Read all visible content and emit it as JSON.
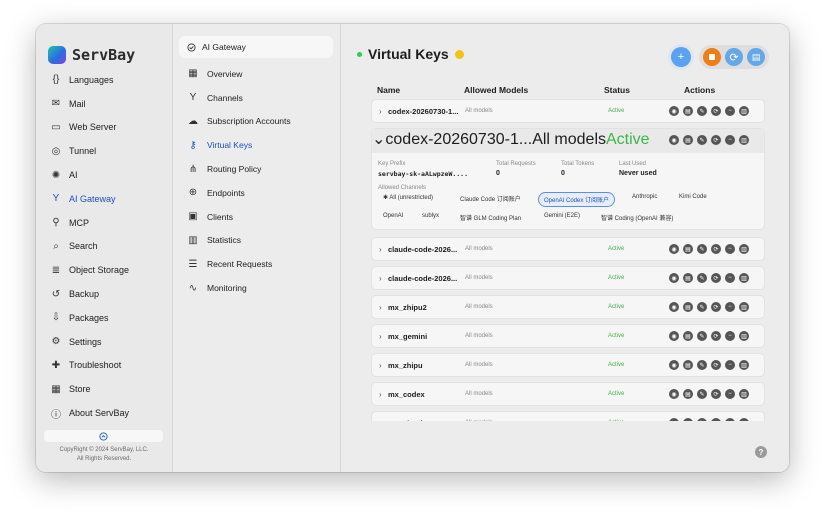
{
  "app": {
    "name": "ServBay"
  },
  "sidebar": {
    "items": [
      {
        "label": "Languages",
        "icon": "code-braces-icon"
      },
      {
        "label": "Mail",
        "icon": "mail-icon"
      },
      {
        "label": "Web Server",
        "icon": "server-icon"
      },
      {
        "label": "Tunnel",
        "icon": "tunnel-icon"
      },
      {
        "label": "AI",
        "icon": "ai-chip-icon"
      },
      {
        "label": "AI Gateway",
        "icon": "gateway-icon",
        "active": true
      },
      {
        "label": "MCP",
        "icon": "mcp-icon"
      },
      {
        "label": "Search",
        "icon": "search-icon"
      },
      {
        "label": "Object Storage",
        "icon": "storage-icon"
      },
      {
        "label": "Backup",
        "icon": "backup-icon"
      },
      {
        "label": "Packages",
        "icon": "packages-icon"
      },
      {
        "label": "Settings",
        "icon": "gear-icon"
      },
      {
        "label": "Troubleshoot",
        "icon": "troubleshoot-icon"
      },
      {
        "label": "Store",
        "icon": "store-icon"
      },
      {
        "label": "About ServBay",
        "icon": "info-icon"
      }
    ],
    "copyright_line1": "CopyRight © 2024 ServBay, LLC.",
    "copyright_line2": "All Rights Reserved."
  },
  "subnav": {
    "header": "AI Gateway",
    "items": [
      {
        "label": "Overview",
        "icon": "grid-icon"
      },
      {
        "label": "Channels",
        "icon": "channels-icon"
      },
      {
        "label": "Subscription Accounts",
        "icon": "accounts-icon"
      },
      {
        "label": "Virtual Keys",
        "icon": "key-icon",
        "active": true
      },
      {
        "label": "Routing Policy",
        "icon": "routing-icon"
      },
      {
        "label": "Endpoints",
        "icon": "endpoints-icon"
      },
      {
        "label": "Clients",
        "icon": "terminal-icon"
      },
      {
        "label": "Statistics",
        "icon": "bar-chart-icon"
      },
      {
        "label": "Recent Requests",
        "icon": "list-icon"
      },
      {
        "label": "Monitoring",
        "icon": "pulse-icon"
      }
    ]
  },
  "main": {
    "title": "Virtual Keys",
    "columns": {
      "name": "Name",
      "allowed": "Allowed Models",
      "status": "Status",
      "actions": "Actions"
    },
    "rows": [
      {
        "name": "codex-20260730-1...",
        "allowed": "All models",
        "status": "Active",
        "expanded": false
      },
      {
        "name": "codex-20260730-1...",
        "allowed": "All models",
        "status": "Active",
        "expanded": true
      },
      {
        "name": "claude-code-2026...",
        "allowed": "All models",
        "status": "Active",
        "expanded": false
      },
      {
        "name": "claude-code-2026...",
        "allowed": "All models",
        "status": "Active",
        "expanded": false
      },
      {
        "name": "mx_zhipu2",
        "allowed": "All models",
        "status": "Active",
        "expanded": false
      },
      {
        "name": "mx_gemini",
        "allowed": "All models",
        "status": "Active",
        "expanded": false
      },
      {
        "name": "mx_zhipu",
        "allowed": "All models",
        "status": "Active",
        "expanded": false
      },
      {
        "name": "mx_codex",
        "allowed": "All models",
        "status": "Active",
        "expanded": false
      },
      {
        "name": "mx_claude",
        "allowed": "All models",
        "status": "Active",
        "expanded": false
      }
    ],
    "detail": {
      "key_prefix_label": "Key Prefix",
      "key_prefix": "servbay-sk-aALwpzeW....",
      "total_requests_label": "Total Requests",
      "total_requests": "0",
      "total_tokens_label": "Total Tokens",
      "total_tokens": "0",
      "last_used_label": "Last Used",
      "last_used": "Never used",
      "allowed_channels_label": "Allowed Channels",
      "channels": [
        {
          "label": "All (unrestricted)",
          "selected": false
        },
        {
          "label": "Claude Code 订阅账户",
          "selected": false
        },
        {
          "label": "OpenAI Codex 订阅账户",
          "selected": true
        },
        {
          "label": "Anthropic",
          "selected": false
        },
        {
          "label": "Kimi Code",
          "selected": false
        },
        {
          "label": "OpenAI",
          "selected": false
        },
        {
          "label": "sublyx",
          "selected": false
        },
        {
          "label": "智谱 GLM Coding Plan",
          "selected": false
        },
        {
          "label": "Gemini (E2E)",
          "selected": false
        },
        {
          "label": "智谱 Coding (OpenAI 兼容)",
          "selected": false
        }
      ]
    },
    "help_label": "?"
  },
  "colors": {
    "accent": "#1f4fbf",
    "active_status": "#3fb54a",
    "stop": "#ef7d18",
    "add": "#5aa1ee"
  }
}
